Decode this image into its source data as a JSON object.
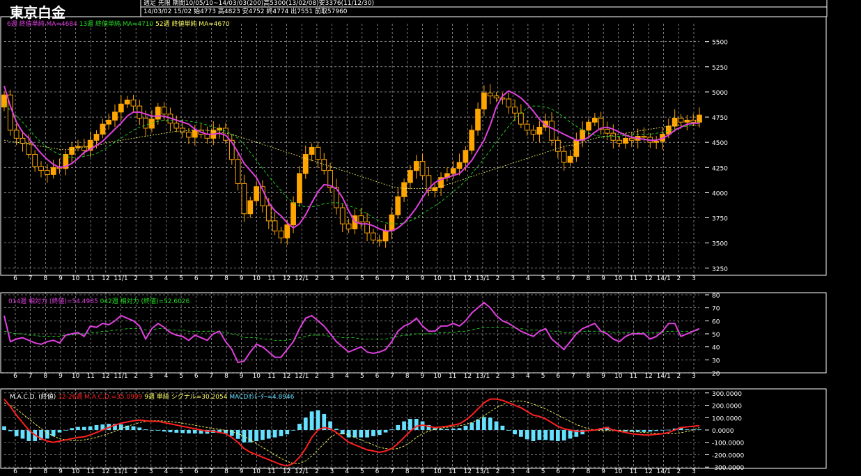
{
  "header": {
    "title": "東京白金",
    "info_line1": "週足 先限 期間10/05/10~14/03/03(200)高5300(13/02/08)安3376(11/12/30)",
    "info_line2": "14/03/02 15/02 始4773 高4823 安4752 終4774 出7551 前取57960"
  },
  "colors": {
    "up_candle": "#FFA500",
    "ma6": "#E040E0",
    "ma13": "#22DD22",
    "ma52": "#FFFF66",
    "grid": "#CCCCCC",
    "rsi14": "#E040E0",
    "rsi42": "#22DD22",
    "macd": "#FF2020",
    "signal": "#FFFF66",
    "osc": "#66E0FF"
  },
  "legends": {
    "price": [
      "6週 終値単純 MA=4684",
      "13週 終値単純 MA=4710",
      "52週 終値単純 MA=4670"
    ],
    "rsi": [
      "014週 相対力 (終値)=54.4985",
      "042週 相対力 (終値)=52.6026"
    ],
    "macd": [
      "M.A.C.D. (終値)",
      "12-26週 M.A.C.D.=35.0999",
      "9週 単純 シグナル=30.2054",
      "MACDｵｼﾚｰﾀｰ=4.8946"
    ]
  },
  "x_labels": [
    "6",
    "7",
    "8",
    "9",
    "10",
    "11",
    "12",
    "11/1",
    "2",
    "3",
    "4",
    "5",
    "6",
    "7",
    "8",
    "9",
    "10",
    "11",
    "12",
    "12/1",
    "2",
    "3",
    "4",
    "5",
    "6",
    "7",
    "8",
    "9",
    "10",
    "11",
    "12",
    "13/1",
    "2",
    "3",
    "4",
    "5",
    "6",
    "7",
    "8",
    "9",
    "10",
    "11",
    "12",
    "14/1",
    "2",
    "3"
  ],
  "chart_data": [
    {
      "type": "candlestick",
      "title": "東京白金",
      "yticks": [
        3250,
        3500,
        3750,
        4000,
        4250,
        4500,
        4750,
        5000,
        5250,
        5500
      ],
      "ylim": [
        3200,
        5650
      ],
      "grid": true,
      "close": [
        4970,
        4620,
        4540,
        4490,
        4380,
        4260,
        4220,
        4180,
        4250,
        4240,
        4380,
        4450,
        4460,
        4420,
        4520,
        4580,
        4680,
        4720,
        4800,
        4880,
        4920,
        4860,
        4740,
        4640,
        4730,
        4850,
        4780,
        4690,
        4640,
        4600,
        4550,
        4620,
        4580,
        4540,
        4620,
        4640,
        4520,
        4330,
        4090,
        3790,
        3920,
        4060,
        3870,
        3720,
        3620,
        3550,
        3680,
        3900,
        4190,
        4380,
        4450,
        4330,
        4220,
        4050,
        3850,
        3690,
        3640,
        3770,
        3710,
        3600,
        3530,
        3520,
        3620,
        3780,
        3960,
        4100,
        4220,
        4310,
        4170,
        4020,
        4050,
        4150,
        4190,
        4240,
        4300,
        4420,
        4620,
        4830,
        4990,
        4960,
        4940,
        4930,
        4850,
        4790,
        4680,
        4620,
        4580,
        4650,
        4710,
        4520,
        4410,
        4300,
        4360,
        4520,
        4620,
        4700,
        4740,
        4630,
        4590,
        4520,
        4490,
        4540,
        4520,
        4560,
        4550,
        4500,
        4510,
        4580,
        4660,
        4740,
        4700,
        4720,
        4700,
        4770
      ],
      "ma": [
        {
          "name": "6週",
          "values": [
            5060,
            4860,
            4700,
            4600,
            4540,
            4460,
            4390,
            4330,
            4280,
            4250,
            4260,
            4290,
            4340,
            4400,
            4430,
            4470,
            4510,
            4570,
            4630,
            4690,
            4760,
            4800,
            4800,
            4780,
            4760,
            4760,
            4760,
            4740,
            4720,
            4700,
            4680,
            4630,
            4600,
            4580,
            4580,
            4590,
            4570,
            4500,
            4400,
            4290,
            4220,
            4150,
            4030,
            3900,
            3820,
            3770,
            3700,
            3650,
            3690,
            3780,
            3900,
            4010,
            4080,
            4070,
            4040,
            3950,
            3820,
            3710,
            3690,
            3690,
            3670,
            3640,
            3620,
            3620,
            3650,
            3700,
            3770,
            3850,
            3950,
            4040,
            4100,
            4130,
            4150,
            4170,
            4190,
            4250,
            4320,
            4420,
            4520,
            4670,
            4850,
            4960,
            5010,
            4980,
            4940,
            4880,
            4810,
            4730,
            4670,
            4640,
            4610,
            4580,
            4550,
            4520,
            4520,
            4550,
            4600,
            4640,
            4650,
            4630,
            4600,
            4570,
            4550,
            4540,
            4530,
            4520,
            4520,
            4540,
            4570,
            4620,
            4650,
            4680,
            4690,
            4690
          ]
        },
        {
          "name": "13週",
          "values": [
            4870,
            4820,
            4760,
            4700,
            4630,
            4560,
            4500,
            4450,
            4410,
            4380,
            4360,
            4350,
            4350,
            4360,
            4370,
            4390,
            4420,
            4460,
            4500,
            4540,
            4580,
            4620,
            4650,
            4670,
            4690,
            4710,
            4720,
            4720,
            4720,
            4720,
            4710,
            4700,
            4690,
            4670,
            4650,
            4630,
            4610,
            4580,
            4540,
            4480,
            4400,
            4320,
            4240,
            4160,
            4090,
            4020,
            3950,
            3900,
            3870,
            3860,
            3860,
            3870,
            3890,
            3900,
            3900,
            3890,
            3870,
            3850,
            3820,
            3790,
            3750,
            3720,
            3700,
            3690,
            3690,
            3700,
            3720,
            3750,
            3790,
            3830,
            3870,
            3910,
            3960,
            4010,
            4060,
            4120,
            4190,
            4260,
            4340,
            4420,
            4500,
            4580,
            4660,
            4730,
            4790,
            4840,
            4860,
            4860,
            4850,
            4830,
            4790,
            4750,
            4700,
            4660,
            4620,
            4590,
            4570,
            4560,
            4560,
            4560,
            4560,
            4570,
            4570,
            4580,
            4580,
            4580,
            4590,
            4600,
            4610,
            4630,
            4650,
            4660,
            4680,
            4710
          ]
        },
        {
          "name": "52週",
          "values": [
            4520,
            4510,
            4500,
            4490,
            4480,
            4470,
            4460,
            4450,
            4440,
            4430,
            4430,
            4430,
            4440,
            4450,
            4460,
            4470,
            4480,
            4500,
            4510,
            4520,
            4530,
            4540,
            4550,
            4560,
            4570,
            4580,
            4590,
            4600,
            4610,
            4610,
            4620,
            4620,
            4620,
            4620,
            4610,
            4600,
            4590,
            4580,
            4560,
            4540,
            4520,
            4500,
            4480,
            4460,
            4440,
            4420,
            4400,
            4380,
            4360,
            4340,
            4320,
            4300,
            4280,
            4260,
            4240,
            4220,
            4200,
            4180,
            4160,
            4140,
            4120,
            4100,
            4080,
            4060,
            4050,
            4040,
            4040,
            4040,
            4040,
            4040,
            4050,
            4060,
            4080,
            4100,
            4120,
            4140,
            4160,
            4180,
            4200,
            4220,
            4240,
            4260,
            4280,
            4300,
            4320,
            4340,
            4360,
            4380,
            4400,
            4420,
            4440,
            4460,
            4470,
            4480,
            4500,
            4520,
            4540,
            4550,
            4560,
            4570,
            4580,
            4590,
            4600,
            4610,
            4620,
            4630,
            4640,
            4650,
            4660,
            4670,
            4670,
            4670,
            4670,
            4670
          ]
        }
      ]
    },
    {
      "type": "line",
      "title": "相対力",
      "yticks": [
        20,
        30,
        40,
        50,
        60,
        70,
        80
      ],
      "ylim": [
        20,
        80
      ],
      "series": [
        {
          "name": "014週 相対力 (終値)",
          "values": [
            64,
            44,
            46,
            47,
            45,
            43,
            42,
            44,
            45,
            43,
            49,
            50,
            51,
            48,
            56,
            55,
            58,
            57,
            60,
            64,
            62,
            60,
            56,
            46,
            54,
            58,
            55,
            51,
            49,
            48,
            45,
            49,
            47,
            45,
            50,
            52,
            44,
            38,
            28,
            29,
            36,
            42,
            40,
            36,
            32,
            32,
            38,
            44,
            54,
            62,
            64,
            60,
            56,
            50,
            44,
            40,
            36,
            38,
            40,
            36,
            35,
            36,
            38,
            44,
            52,
            56,
            58,
            62,
            56,
            52,
            52,
            56,
            56,
            58,
            56,
            60,
            66,
            70,
            74,
            70,
            64,
            60,
            58,
            55,
            52,
            50,
            48,
            52,
            54,
            46,
            42,
            38,
            44,
            50,
            54,
            56,
            58,
            52,
            50,
            46,
            44,
            48,
            50,
            50,
            50,
            46,
            48,
            52,
            58,
            58,
            48,
            50,
            52,
            54
          ]
        },
        {
          "name": "042週 相対力 (終値)",
          "values": [
            52,
            51,
            50,
            50,
            49,
            49,
            48,
            48,
            48,
            48,
            49,
            49,
            50,
            50,
            51,
            51,
            52,
            52,
            53,
            53,
            54,
            54,
            54,
            53,
            53,
            54,
            54,
            53,
            53,
            53,
            52,
            52,
            52,
            52,
            52,
            52,
            51,
            50,
            49,
            47,
            47,
            47,
            46,
            46,
            45,
            45,
            45,
            46,
            47,
            48,
            49,
            49,
            49,
            48,
            48,
            47,
            47,
            47,
            46,
            46,
            46,
            46,
            46,
            47,
            48,
            49,
            49,
            50,
            50,
            50,
            50,
            51,
            51,
            51,
            52,
            52,
            53,
            54,
            55,
            55,
            55,
            55,
            55,
            54,
            54,
            53,
            53,
            53,
            53,
            52,
            52,
            51,
            51,
            51,
            52,
            52,
            52,
            52,
            52,
            51,
            51,
            51,
            51,
            51,
            51,
            51,
            51,
            51,
            52,
            52,
            52,
            52,
            52,
            53
          ]
        }
      ]
    },
    {
      "type": "line",
      "title": "M.A.C.D. (終値)",
      "yticks": [
        -300,
        -200,
        -100,
        0,
        100,
        200,
        300
      ],
      "ylim": [
        -310,
        310
      ],
      "series": [
        {
          "name": "12-26週 M.A.C.D.",
          "values": [
            250,
            190,
            120,
            60,
            0,
            -40,
            -70,
            -90,
            -100,
            -90,
            -80,
            -70,
            -60,
            -55,
            -40,
            -20,
            0,
            20,
            40,
            55,
            65,
            75,
            80,
            75,
            70,
            70,
            60,
            50,
            40,
            30,
            20,
            10,
            0,
            -10,
            -10,
            -20,
            -30,
            -60,
            -100,
            -150,
            -180,
            -200,
            -220,
            -240,
            -260,
            -280,
            -290,
            -270,
            -220,
            -150,
            -60,
            0,
            20,
            10,
            -20,
            -60,
            -100,
            -120,
            -140,
            -160,
            -170,
            -180,
            -170,
            -150,
            -110,
            -60,
            -10,
            30,
            40,
            30,
            20,
            25,
            30,
            40,
            50,
            80,
            120,
            170,
            220,
            250,
            250,
            240,
            220,
            200,
            180,
            150,
            120,
            110,
            90,
            60,
            30,
            10,
            0,
            -10,
            -10,
            -5,
            0,
            10,
            20,
            0,
            -10,
            -20,
            -30,
            -35,
            -40,
            -40,
            -35,
            -30,
            -20,
            0,
            20,
            25,
            30,
            35
          ]
        },
        {
          "name": "9週 単純 シグナル",
          "values": [
            220,
            200,
            170,
            130,
            90,
            50,
            10,
            -20,
            -50,
            -70,
            -80,
            -85,
            -85,
            -80,
            -70,
            -60,
            -45,
            -30,
            -10,
            10,
            30,
            45,
            60,
            70,
            75,
            75,
            72,
            68,
            62,
            55,
            47,
            38,
            30,
            20,
            12,
            5,
            -2,
            -12,
            -28,
            -50,
            -80,
            -110,
            -140,
            -170,
            -200,
            -230,
            -255,
            -270,
            -270,
            -250,
            -210,
            -160,
            -110,
            -60,
            -30,
            -25,
            -40,
            -60,
            -80,
            -100,
            -120,
            -140,
            -150,
            -155,
            -150,
            -130,
            -100,
            -60,
            -30,
            -10,
            5,
            15,
            22,
            28,
            35,
            45,
            60,
            85,
            115,
            150,
            180,
            205,
            225,
            235,
            235,
            225,
            210,
            190,
            170,
            145,
            120,
            95,
            70,
            45,
            25,
            10,
            0,
            -5,
            -5,
            -5,
            -5,
            -8,
            -12,
            -16,
            -20,
            -24,
            -27,
            -30,
            -30,
            -28,
            -22,
            -12,
            0,
            20
          ]
        },
        {
          "name": "MACDｵｼﾚｰﾀｰ",
          "values": [
            30,
            -10,
            -50,
            -70,
            -90,
            -90,
            -80,
            -70,
            -50,
            -20,
            0,
            15,
            25,
            25,
            30,
            40,
            45,
            50,
            50,
            45,
            35,
            30,
            20,
            5,
            -5,
            -5,
            -12,
            -18,
            -22,
            -25,
            -27,
            -28,
            -30,
            -30,
            -22,
            -25,
            -28,
            -48,
            -72,
            -100,
            -100,
            -90,
            -80,
            -70,
            -60,
            -50,
            -35,
            0,
            50,
            100,
            150,
            160,
            130,
            70,
            10,
            -35,
            -60,
            -60,
            -60,
            -60,
            -50,
            -40,
            -20,
            5,
            40,
            70,
            90,
            90,
            70,
            40,
            15,
            10,
            8,
            12,
            15,
            35,
            60,
            85,
            105,
            100,
            70,
            35,
            -5,
            -35,
            -55,
            -75,
            -90,
            -80,
            -80,
            -85,
            -90,
            -85,
            -70,
            -55,
            -35,
            -5,
            0,
            15,
            25,
            5,
            -10,
            -12,
            -14,
            -15,
            -16,
            -13,
            -8,
            -2,
            2,
            12,
            20,
            5,
            5,
            5
          ]
        }
      ]
    }
  ]
}
